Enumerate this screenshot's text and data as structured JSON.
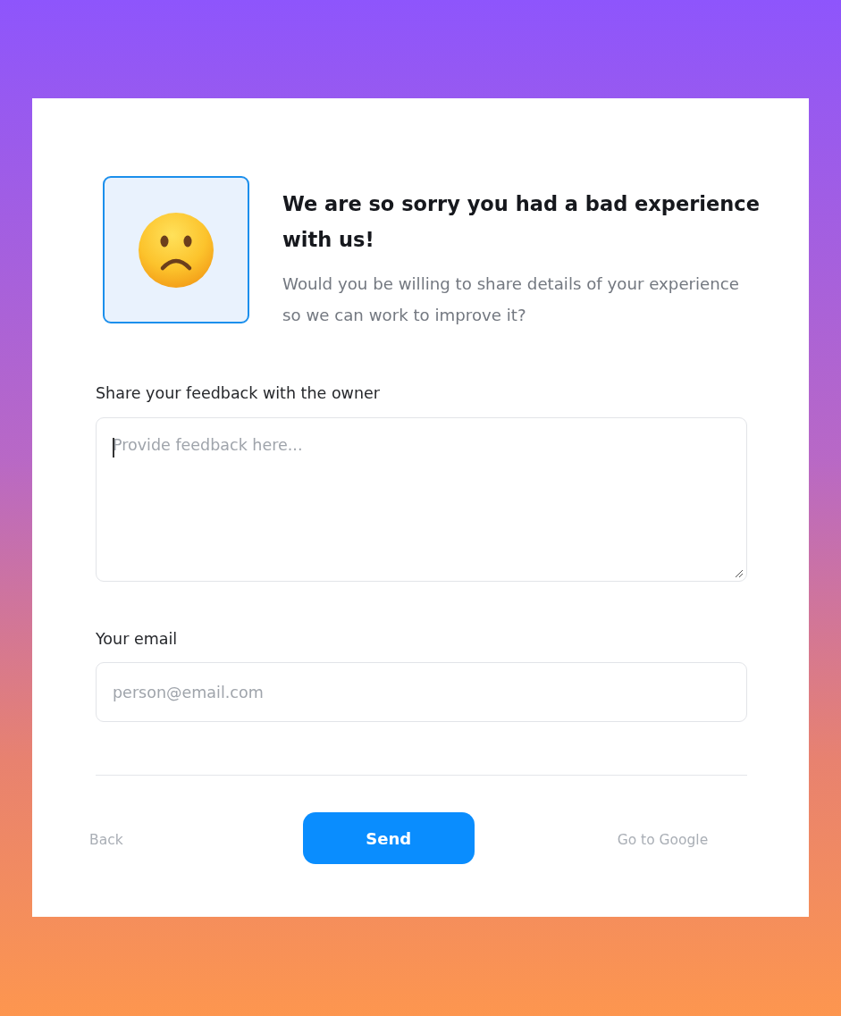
{
  "header": {
    "title": "We are so sorry you had a bad experience with us!",
    "subtitle": "Would you be willing to share details of your experience so we can work to improve it?"
  },
  "feedback": {
    "label": "Share your feedback with the owner",
    "placeholder": "Provide feedback here...",
    "focused": true
  },
  "email": {
    "label": "Your email",
    "placeholder": "person@email.com"
  },
  "actions": [
    {
      "label": "Back",
      "kind": "link"
    },
    {
      "label": "Send",
      "kind": "primary"
    },
    {
      "label": "Go to Google",
      "kind": "link"
    }
  ]
}
